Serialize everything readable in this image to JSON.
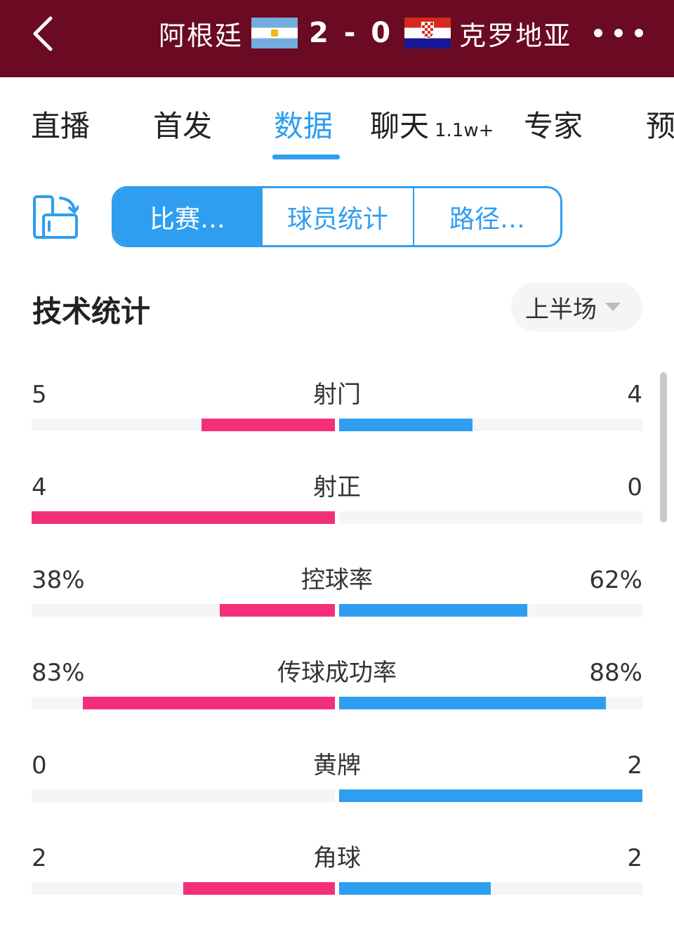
{
  "header": {
    "home_team": "阿根廷",
    "score": "2 - 0",
    "away_team": "克罗地亚",
    "background": "#6b0a23"
  },
  "tabs": [
    {
      "label": "直播",
      "badge": ""
    },
    {
      "label": "首发",
      "badge": ""
    },
    {
      "label": "数据",
      "badge": "",
      "active": true
    },
    {
      "label": "聊天",
      "badge": "1.1w+"
    },
    {
      "label": "专家",
      "badge": ""
    },
    {
      "label": "预",
      "badge": ""
    }
  ],
  "segments": [
    {
      "label": "比赛…",
      "active": true
    },
    {
      "label": "球员统计"
    },
    {
      "label": "路径…"
    }
  ],
  "section": {
    "title": "技术统计",
    "period": "上半场"
  },
  "colors": {
    "home": "#f42f7a",
    "away": "#2f9ef0",
    "accent": "#2f9ef0"
  },
  "stats": [
    {
      "name": "射门",
      "left": "5",
      "right": "4",
      "left_ratio": 0.44,
      "right_ratio": 0.44
    },
    {
      "name": "射正",
      "left": "4",
      "right": "0",
      "left_ratio": 1.0,
      "right_ratio": 0.0
    },
    {
      "name": "控球率",
      "left": "38%",
      "right": "62%",
      "left_ratio": 0.38,
      "right_ratio": 0.62
    },
    {
      "name": "传球成功率",
      "left": "83%",
      "right": "88%",
      "left_ratio": 0.83,
      "right_ratio": 0.88
    },
    {
      "name": "黄牌",
      "left": "0",
      "right": "2",
      "left_ratio": 0.0,
      "right_ratio": 1.0
    },
    {
      "name": "角球",
      "left": "2",
      "right": "2",
      "left_ratio": 0.5,
      "right_ratio": 0.5
    }
  ]
}
